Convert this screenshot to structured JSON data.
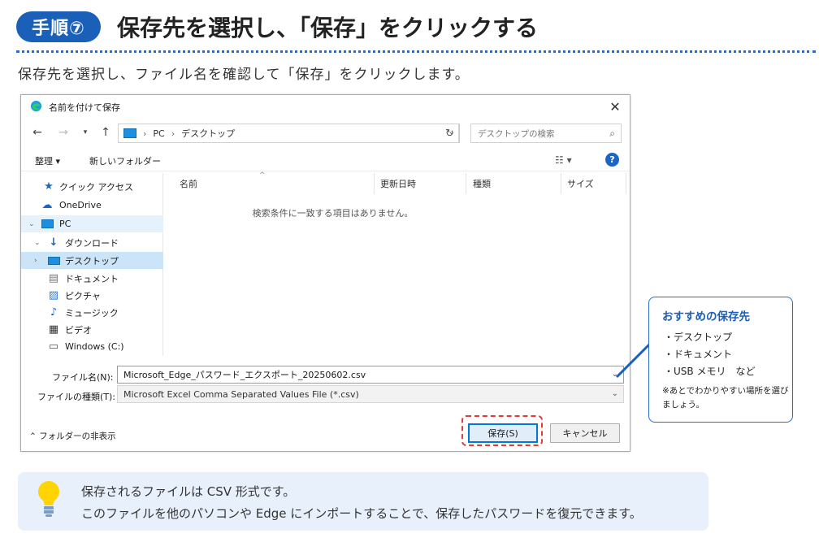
{
  "header": {
    "step_label": "手順⑦",
    "title": "保存先を選択し、「保存」をクリックする",
    "subtitle": "保存先を選択し、ファイル名を確認して「保存」をクリックします。"
  },
  "dialog": {
    "title": "名前を付けて保存",
    "breadcrumb": [
      "PC",
      "デスクトップ"
    ],
    "search_placeholder": "デスクトップの検索",
    "toolbar": {
      "organize": "整理 ▾",
      "new_folder": "新しいフォルダー"
    },
    "nav": [
      {
        "label": "クイック アクセス",
        "icon": "star-icon"
      },
      {
        "label": "OneDrive",
        "icon": "cloud-icon"
      },
      {
        "label": "PC",
        "icon": "pc-icon"
      },
      {
        "label": "ダウンロード",
        "icon": "download-icon"
      },
      {
        "label": "デスクトップ",
        "icon": "desktop-icon"
      },
      {
        "label": "ドキュメント",
        "icon": "document-icon"
      },
      {
        "label": "ピクチャ",
        "icon": "picture-icon"
      },
      {
        "label": "ミュージック",
        "icon": "music-icon"
      },
      {
        "label": "ビデオ",
        "icon": "video-icon"
      },
      {
        "label": "Windows (C:)",
        "icon": "drive-icon"
      }
    ],
    "columns": [
      "名前",
      "更新日時",
      "種類",
      "サイズ"
    ],
    "empty_message": "検索条件に一致する項目はありません。",
    "filename_label": "ファイル名(N):",
    "filename_value": "Microsoft_Edge_パスワード_エクスポート_20250602.csv",
    "filetype_label": "ファイルの種類(T):",
    "filetype_value": "Microsoft Excel Comma Separated Values File (*.csv)",
    "hide_folders": "フォルダーの非表示",
    "save_button": "保存(S)",
    "cancel_button": "キャンセル"
  },
  "callout": {
    "title": "おすすめの保存先",
    "items": [
      "・デスクトップ",
      "・ドキュメント",
      "・USB メモリ　など"
    ],
    "note": "※あとでわかりやすい場所を選びましょう。"
  },
  "tip": {
    "line1": "保存されるファイルは CSV 形式です。",
    "line2": "このファイルを他のパソコンや Edge にインポートすることで、保存したパスワードを復元できます。"
  },
  "colors": {
    "accent": "#1a5fb8",
    "highlight": "#e33a3a",
    "tip_bg": "#e8f0fb",
    "selection": "#cce4f7"
  }
}
